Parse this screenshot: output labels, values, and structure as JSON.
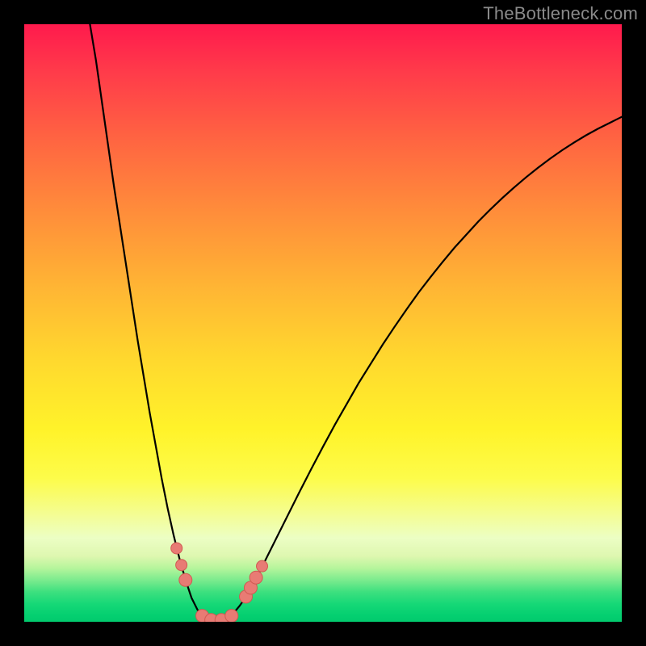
{
  "watermark": "TheBottleneck.com",
  "colors": {
    "frame": "#000000",
    "curve_stroke": "#000000",
    "marker_fill": "#e87b74",
    "marker_stroke": "#d05a52"
  },
  "chart_data": {
    "type": "line",
    "title": "",
    "xlabel": "",
    "ylabel": "",
    "xlim": [
      0,
      100
    ],
    "ylim": [
      0,
      100
    ],
    "grid": false,
    "series": [
      {
        "name": "curve",
        "x": [
          11,
          12,
          13,
          14,
          15,
          16,
          17,
          18,
          19,
          20,
          21,
          22,
          23,
          24,
          25,
          26,
          27,
          28,
          29,
          30,
          31,
          32,
          33,
          34,
          35,
          36,
          37,
          38,
          39,
          40,
          42,
          44,
          46,
          48,
          50,
          52,
          54,
          56,
          58,
          60,
          62,
          64,
          66,
          68,
          70,
          72,
          74,
          76,
          78,
          80,
          82,
          84,
          86,
          88,
          90,
          92,
          94,
          96,
          98,
          100
        ],
        "y": [
          100,
          94,
          87,
          80,
          73,
          66.5,
          60,
          53.5,
          47,
          41,
          35,
          29.5,
          24,
          19,
          14.5,
          10.5,
          7,
          4,
          2,
          0.7,
          0.2,
          0.1,
          0.2,
          0.6,
          1.4,
          2.6,
          4,
          5.7,
          7.6,
          9.6,
          13.6,
          17.6,
          21.6,
          25.5,
          29.3,
          33,
          36.5,
          40,
          43.2,
          46.4,
          49.4,
          52.3,
          55.1,
          57.7,
          60.2,
          62.6,
          64.8,
          67,
          69,
          70.9,
          72.7,
          74.4,
          76,
          77.5,
          78.9,
          80.2,
          81.4,
          82.5,
          83.5,
          84.5
        ]
      }
    ],
    "markers": [
      {
        "x": 25.5,
        "y": 12.3,
        "r": 7
      },
      {
        "x": 26.3,
        "y": 9.5,
        "r": 7
      },
      {
        "x": 27.0,
        "y": 7.0,
        "r": 8
      },
      {
        "x": 29.8,
        "y": 1.0,
        "r": 8
      },
      {
        "x": 31.3,
        "y": 0.3,
        "r": 8
      },
      {
        "x": 33.0,
        "y": 0.3,
        "r": 8
      },
      {
        "x": 34.7,
        "y": 1.0,
        "r": 8
      },
      {
        "x": 37.1,
        "y": 4.2,
        "r": 8
      },
      {
        "x": 37.9,
        "y": 5.7,
        "r": 8
      },
      {
        "x": 38.8,
        "y": 7.4,
        "r": 8
      },
      {
        "x": 39.8,
        "y": 9.3,
        "r": 7
      }
    ]
  }
}
